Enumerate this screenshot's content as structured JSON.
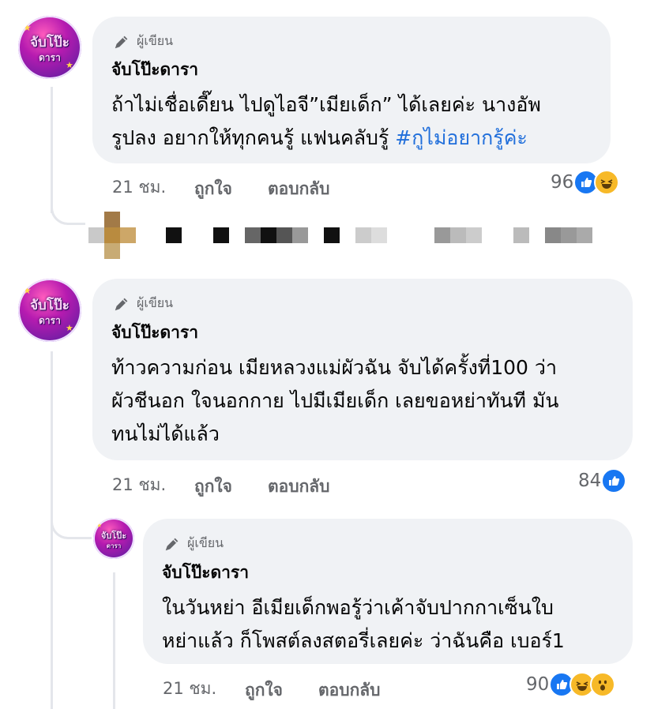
{
  "comments": [
    {
      "badge": "ผู้เขียน",
      "author": "จับโป๊ะดารา",
      "lines": [
        "ถ้าไม่เชื่อเดี๊ยน ไปดูไอจี”เมียเด็ก” ได้เลยค่ะ นางอัพ",
        "รูปลง อยากให้ทุกคนรู้ แฟนคลับรู้ "
      ],
      "hashtag": "#กูไม่อยากรู้ค่ะ",
      "time": "21 ชม.",
      "like_label": "ถูกใจ",
      "reply_label": "ตอบกลับ",
      "reaction_count": "96"
    },
    {
      "badge": "ผู้เขียน",
      "author": "จับโป๊ะดารา",
      "lines": [
        "ท้าวความก่อน เมียหลวงแม่ผัวฉัน จับได้ครั้งที่100 ว่า",
        "ผัวชีนอก ใจนอกกาย ไปมีเมียเด็ก เลยขอหย่าทันที มัน",
        "ทนไม่ได้แล้ว"
      ],
      "time": "21 ชม.",
      "like_label": "ถูกใจ",
      "reply_label": "ตอบกลับ",
      "reaction_count": "84"
    },
    {
      "badge": "ผู้เขียน",
      "author": "จับโป๊ะดารา",
      "lines": [
        "ในวันหย่า อีเมียเด็กพอรู้ว่าเค้าจับปากกาเซ็นใบ",
        "หย่าแล้ว ก็โพสต์ลงสตอรี่เลยค่ะ ว่าฉันคือ เบอร์1"
      ],
      "time": "21 ชม.",
      "like_label": "ถูกใจ",
      "reply_label": "ตอบกลับ",
      "reaction_count": "90"
    }
  ],
  "avatar_text": {
    "top": "จับโป๊ะ",
    "bottom": "ดารา"
  },
  "colors": {
    "bubble": "#f0f2f5",
    "meta": "#65676b",
    "hashtag": "#216fdb",
    "like": "#1877f2",
    "emoji": "#f7b928"
  }
}
